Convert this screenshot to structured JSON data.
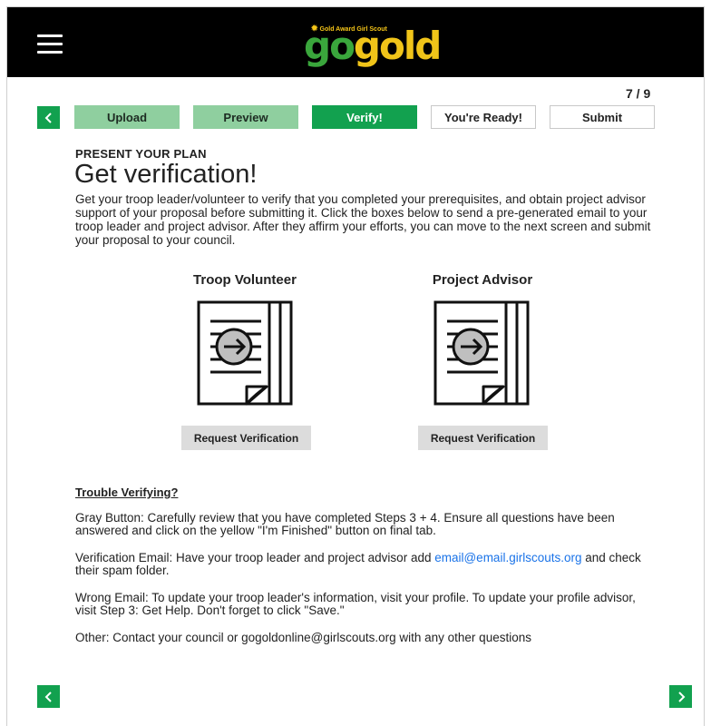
{
  "header": {
    "logo_tagline": "Gold Award Girl Scout",
    "logo_go": "go",
    "logo_gold": "gold"
  },
  "progress": {
    "counter": "7 / 9"
  },
  "steps": [
    {
      "label": "Upload",
      "state": "done"
    },
    {
      "label": "Preview",
      "state": "done"
    },
    {
      "label": "Verify!",
      "state": "active"
    },
    {
      "label": "You're Ready!",
      "state": "todo"
    },
    {
      "label": "Submit",
      "state": "todo"
    }
  ],
  "colors": {
    "accent": "#12a14f",
    "done": "#8fcf9f",
    "go": "#3aa63c",
    "gold": "#f0c419",
    "link": "#1a73e8"
  },
  "content": {
    "section_label": "PRESENT YOUR PLAN",
    "title": "Get verification!",
    "intro": "Get your troop leader/volunteer to verify that you completed your prerequisites, and obtain project advisor support of your proposal before submitting it. Click the boxes below to send a pre-generated email to your troop leader and project advisor. After they affirm your efforts, you can move to the next screen and submit your proposal to your council."
  },
  "cards": [
    {
      "title": "Troop Volunteer",
      "button": "Request Verification",
      "icon": "document-arrow-icon"
    },
    {
      "title": "Project Advisor",
      "button": "Request Verification",
      "icon": "document-arrow-icon"
    }
  ],
  "trouble": {
    "heading": "Trouble Verifying?",
    "gray_button": "Gray Button: Carefully review that you have completed Steps 3 + 4. Ensure all questions have been answered and click on the yellow \"I'm Finished\" button on final tab.",
    "email_prefix": "Verification Email: Have your troop leader and project advisor add ",
    "email_link": "email@email.girlscouts.org",
    "email_suffix": " and check their spam folder.",
    "wrong_email": "Wrong Email: To update your troop leader's information, visit your profile. To update your profile advisor, visit Step 3: Get Help. Don't forget to click \"Save.\"",
    "other": "Other: Contact your council or gogoldonline@girlscouts.org with any other questions"
  },
  "nav": {
    "prev_icon": "chevron-left-icon",
    "next_icon": "chevron-right-icon"
  }
}
